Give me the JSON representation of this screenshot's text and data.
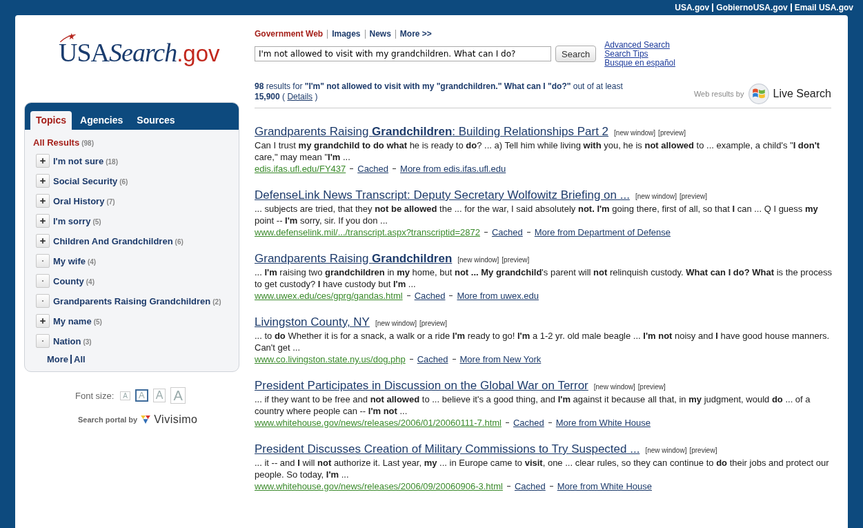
{
  "top_links": [
    "USA.gov",
    "GobiernoUSA.gov",
    "Email USA.gov"
  ],
  "logo": {
    "usa": "USA",
    "search": "Search",
    "gov": ".gov"
  },
  "nav": [
    {
      "label": "Government Web",
      "selected": true
    },
    {
      "label": "Images",
      "selected": false
    },
    {
      "label": "News",
      "selected": false
    },
    {
      "label": "More >>",
      "selected": false
    }
  ],
  "search": {
    "value": "I'm not allowed to visit with my grandchildren. What can I do?",
    "button": "Search"
  },
  "side_links": [
    "Advanced Search",
    "Search Tips",
    "Busque en español"
  ],
  "sidebar": {
    "tabs": [
      {
        "label": "Topics",
        "selected": true
      },
      {
        "label": "Agencies",
        "selected": false
      },
      {
        "label": "Sources",
        "selected": false
      }
    ],
    "all": {
      "label": "All Results",
      "count": "(98)"
    },
    "items": [
      {
        "label": "I'm not sure",
        "count": "(18)",
        "expandable": true
      },
      {
        "label": "Social Security",
        "count": "(6)",
        "expandable": true
      },
      {
        "label": "Oral History",
        "count": "(7)",
        "expandable": true
      },
      {
        "label": "I'm sorry",
        "count": "(5)",
        "expandable": true
      },
      {
        "label": "Children And Grandchildren",
        "count": "(6)",
        "expandable": true
      },
      {
        "label": "My wife",
        "count": "(4)",
        "expandable": false
      },
      {
        "label": "County",
        "count": "(4)",
        "expandable": false
      },
      {
        "label": "Grandparents Raising Grandchildren",
        "count": "(2)",
        "expandable": false
      },
      {
        "label": "My name",
        "count": "(5)",
        "expandable": true
      },
      {
        "label": "Nation",
        "count": "(3)",
        "expandable": false
      }
    ],
    "more": "More",
    "all_link": "All"
  },
  "font_size": {
    "label": "Font size:",
    "options": [
      {
        "label": "A",
        "selected": false
      },
      {
        "label": "A",
        "selected": true
      },
      {
        "label": "A",
        "selected": false
      },
      {
        "label": "A",
        "selected": false
      }
    ]
  },
  "portal": {
    "label": "Search portal by",
    "brand": "Vivisimo"
  },
  "summary": {
    "text": "**98** results for **\"I'm\" not allowed to visit with my \"grandchildren.\" What can I \"do?\"** out of at least **15,900** (",
    "details": "Details",
    "close": ")"
  },
  "web_results": {
    "label": "Web results by",
    "brand": "Live Search"
  },
  "results": [
    {
      "title": "Grandparents Raising **Grandchildren**: Building Relationships Part 2",
      "new_window": "[new window]",
      "preview": "[preview]",
      "snippet": "Can I trust **my grandchild to do what** he is ready to **do**? ... a) Tell him while living **with** you, he is **not allowed** to ... example, a child's \"**I don't** care,\" may mean \"**I'm** ...",
      "url": "edis.ifas.ufl.edu/FY437",
      "cached": "Cached",
      "more": "More from edis.ifas.ufl.edu"
    },
    {
      "title": "DefenseLink News Transcript: Deputy Secretary Wolfowitz Briefing on ...",
      "new_window": "[new window]",
      "preview": "[preview]",
      "snippet": "... subjects are tried, that they **not be allowed** the ... for the war, I said absolutely **not. I'm** going there, first of all, so that **I** can ... Q I guess **my** point -- **I'm** sorry, sir. If you don ...",
      "url": "www.defenselink.mil/.../transcript.aspx?transcriptid=2872",
      "cached": "Cached",
      "more": "More from Department of Defense"
    },
    {
      "title": "Grandparents Raising **Grandchildren**",
      "new_window": "[new window]",
      "preview": "[preview]",
      "snippet": "... **I'm** raising two **grandchildren** in **my** home, but **not ... My grandchild**'s parent will **not** relinquish custody. **What can I do? What** is the process to get custody? **I** have custody but **I'm** ...",
      "url": "www.uwex.edu/ces/gprg/gandas.html",
      "cached": "Cached",
      "more": "More from uwex.edu"
    },
    {
      "title": "Livingston County, NY",
      "new_window": "[new window]",
      "preview": "[preview]",
      "snippet": "... to **do** Whether it is for a snack, a walk or a ride **I'm** ready to go! **I'm** a 1-2 yr. old male beagle ... **I'm not** noisy and **I** have good house manners. Can't get ...",
      "url": "www.co.livingston.state.ny.us/dog.php",
      "cached": "Cached",
      "more": "More from New York"
    },
    {
      "title": "President Participates in Discussion on the Global War on Terror",
      "new_window": "[new window]",
      "preview": "[preview]",
      "snippet": "... if they want to be free and **not allowed** to ... believe it's a good thing, and **I'm** against it because all that, in **my** judgment, would **do** ... of a country where people can -- **I'm not** ...",
      "url": "www.whitehouse.gov/news/releases/2006/01/20060111-7.html",
      "cached": "Cached",
      "more": "More from White House"
    },
    {
      "title": "President Discusses Creation of Military Commissions to Try Suspected ...",
      "new_window": "[new window]",
      "preview": "[preview]",
      "snippet": "... it -- and **I** will **not** authorize it. Last year, **my** ... in Europe came to **visit**, one ... clear rules, so they can continue to **do** their jobs and protect our people. So today, **I'm** ...",
      "url": "www.whitehouse.gov/news/releases/2006/09/20060906-3.html",
      "cached": "Cached",
      "more": "More from White House"
    }
  ]
}
